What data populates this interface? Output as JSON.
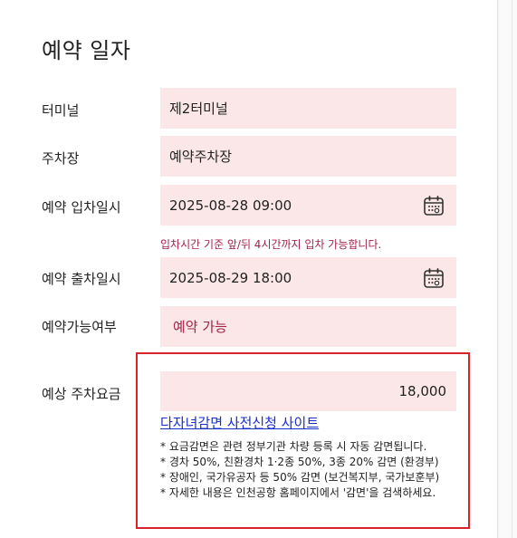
{
  "section": {
    "title": "예약 일자"
  },
  "terminal": {
    "label": "터미널",
    "value": "제2터미널"
  },
  "parking_lot": {
    "label": "주차장",
    "value": "예약주차장"
  },
  "entry": {
    "label": "예약 입차일시",
    "value": "2025-08-28 09:00",
    "icon": "calendar-icon",
    "hint": "입차시간 기준 앞/뒤 4시간까지 입차 가능합니다."
  },
  "exit": {
    "label": "예약 출차일시",
    "value": "2025-08-29 18:00",
    "icon": "calendar-icon"
  },
  "availability": {
    "label": "예약가능여부",
    "value": "예약 가능"
  },
  "fee": {
    "label": "예상 주차요금",
    "value": "18,000",
    "link_text": "다자녀감면 사전신청 사이트",
    "notes": [
      "* 요금감면은 관련 정부기관 차량 등록 시 자동 감면됩니다.",
      "* 경차 50%, 친환경차 1·2종 50%, 3종 20% 감면 (환경부)",
      "* 장애인, 국가유공자 등 50% 감면 (보건복지부, 국가보훈부)",
      "* 자세한 내용은 인천공항 홈페이지에서 '감면'을 검색하세요."
    ]
  },
  "colors": {
    "field_bg": "#fbe7e7",
    "accent": "#a3224a",
    "link": "#1a2fc8",
    "highlight_border": "#d9232b"
  }
}
